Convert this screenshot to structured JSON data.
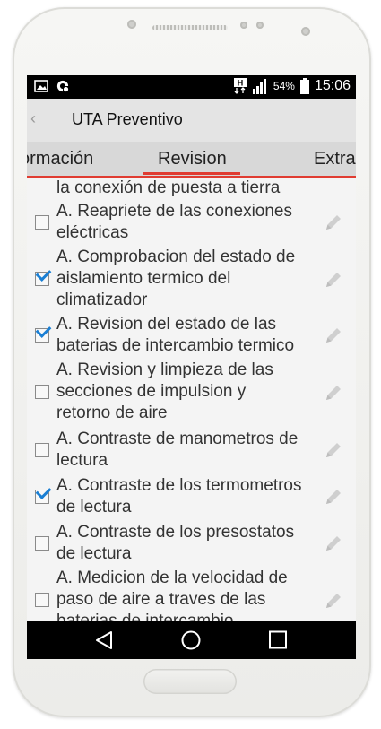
{
  "status_bar": {
    "battery": "54%",
    "time": "15:06",
    "signal_label": "H",
    "icons": [
      "image-icon",
      "notification-icon",
      "network-h-icon",
      "signal-icon",
      "battery-icon"
    ]
  },
  "action_bar": {
    "title": "UTA Preventivo"
  },
  "tabs": {
    "left": "ormación",
    "active": "Revision",
    "right": "Extra"
  },
  "list": {
    "partial_top": "la conexión de puesta a tierra",
    "items": [
      {
        "lines": [
          "A. Reapriete de las conexiones",
          "eléctricas"
        ],
        "checked": false
      },
      {
        "lines": [
          "A. Comprobacion del estado de",
          "aislamiento termico del",
          "climatizador"
        ],
        "checked": true
      },
      {
        "lines": [
          "A. Revision del estado de las",
          "baterias de intercambio termico"
        ],
        "checked": true
      },
      {
        "lines": [
          "A. Revision y limpieza de las",
          "secciones de impulsion y",
          "retorno de aire"
        ],
        "checked": false
      },
      {
        "lines": [
          "A. Contraste de manometros de",
          "lectura"
        ],
        "checked": false
      },
      {
        "lines": [
          "A. Contraste de los termometros",
          "de lectura"
        ],
        "checked": true
      },
      {
        "lines": [
          "A. Contraste de los presostatos",
          "de lectura"
        ],
        "checked": false
      },
      {
        "lines": [
          "A. Medicion de la velocidad de",
          "paso de aire a traves de las",
          "baterias de intercambio"
        ],
        "checked": false
      }
    ]
  },
  "colors": {
    "accent": "#e03c31",
    "check": "#1a7fd4"
  }
}
